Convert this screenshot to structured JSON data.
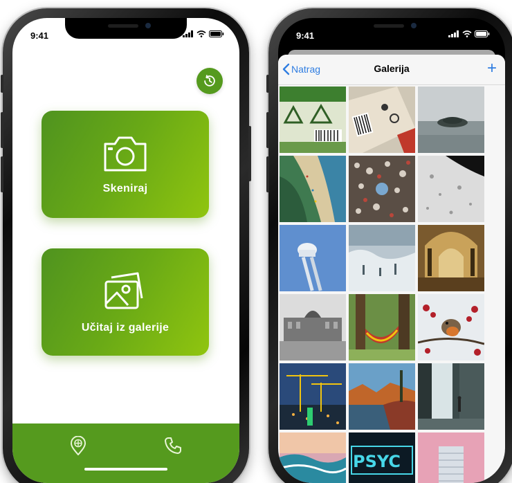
{
  "status": {
    "time": "9:41"
  },
  "scanner_app": {
    "scan_label": "Skeniraj",
    "gallery_label": "Učitaj iz galerije",
    "history_icon": "history-icon",
    "tab_icons": [
      "location-pin-icon",
      "phone-icon"
    ],
    "accent": "#559a1e"
  },
  "gallery_picker": {
    "back_label": "Natrag",
    "title": "Galerija",
    "add_label": "+",
    "link_color": "#2f7de1",
    "photos": [
      "packaging-recycling-symbols",
      "carton-barcode-label",
      "rock-island-in-sea",
      "aerial-beach-coast",
      "aerial-festival-crowd",
      "water-drops-on-glass",
      "water-tower-blue-sky",
      "misty-mountain-fog",
      "cathedral-interior",
      "government-building-square",
      "hammock-between-trees",
      "robin-on-berry-branch",
      "construction-cranes-night",
      "autumn-lake-forest",
      "waterfall-with-person",
      "ocean-waves-sunset",
      "neon-psycho-sign",
      "modern-tower-building"
    ]
  }
}
